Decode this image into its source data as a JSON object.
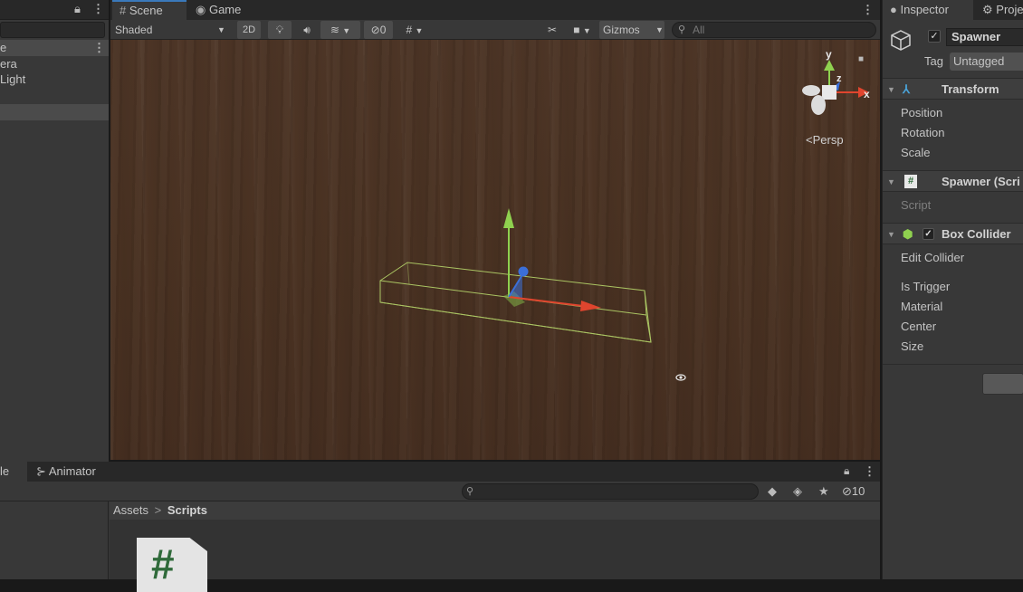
{
  "hierarchy": {
    "scene_row": "e",
    "items": [
      "era",
      "Light",
      ""
    ]
  },
  "scene_tabs": [
    {
      "label": "Scene",
      "icon": "grid-icon"
    },
    {
      "label": "Game",
      "icon": "gamepad-icon"
    }
  ],
  "scene_toolbar": {
    "shading_mode": "Shaded",
    "mode_2d": "2D",
    "hidden_count": "0",
    "gizmos_label": "Gizmos",
    "search_placeholder": "All"
  },
  "viewport": {
    "orientation_axes": [
      "y",
      "z",
      "x"
    ],
    "projection_label": "Persp"
  },
  "bottom": {
    "tabs": [
      "le",
      "Animator"
    ],
    "visible_count": "10",
    "breadcrumb": {
      "root": "Assets",
      "separator": ">",
      "current": "Scripts"
    }
  },
  "inspector": {
    "tabs": [
      "Inspector",
      "Proje"
    ],
    "object_name": "Spawner",
    "tag_label": "Tag",
    "tag_value": "Untagged",
    "components": [
      {
        "title": "Transform",
        "props": [
          "Position",
          "Rotation",
          "Scale"
        ]
      },
      {
        "title": "Spawner (Scri",
        "props": [
          "Script"
        ]
      },
      {
        "title": "Box Collider",
        "props": [
          "Edit Collider",
          "Is Trigger",
          "Material",
          "Center",
          "Size"
        ]
      }
    ]
  },
  "colors": {
    "accent": "#3a79bb",
    "axis_x": "#e0452e",
    "axis_y": "#8fd14f",
    "axis_z": "#3b6fd8",
    "collider": "#b5d46a"
  }
}
